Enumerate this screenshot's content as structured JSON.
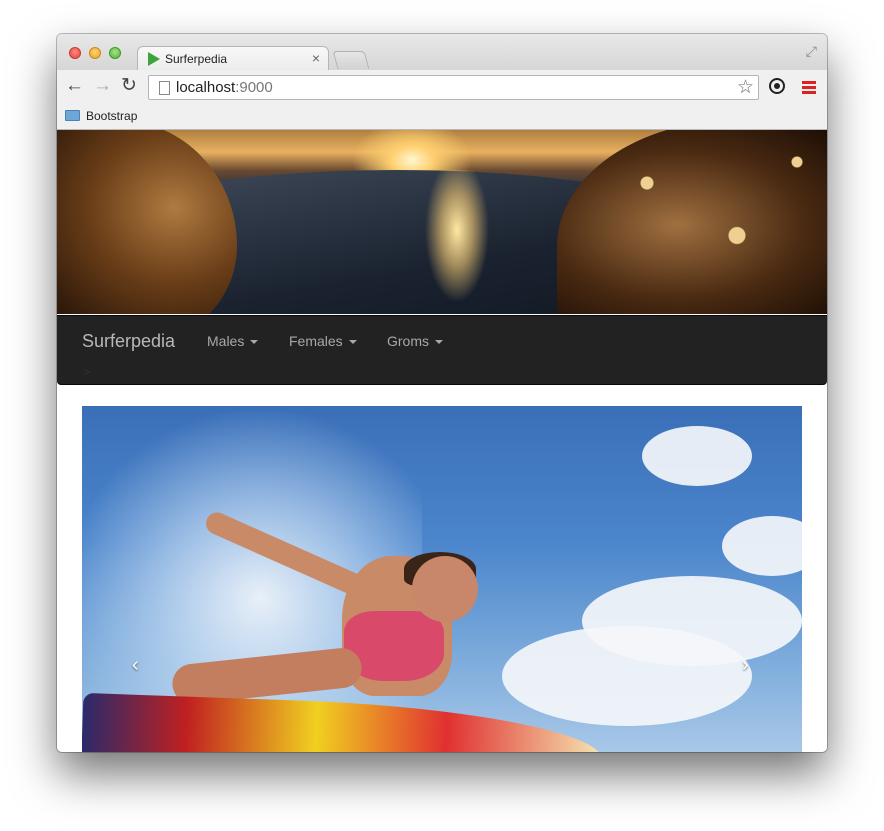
{
  "browser": {
    "tab": {
      "title": "Surferpedia",
      "close_glyph": "×"
    },
    "url": {
      "host": "localhost",
      "port": ":9000"
    },
    "bookmarks": [
      {
        "label": "Bootstrap",
        "icon": "folder-icon"
      }
    ],
    "icons": {
      "back": "←",
      "forward": "→",
      "reload": "↻",
      "star": "☆",
      "fullscreen": "⤢"
    },
    "traffic_lights": {
      "close": "#e0443e",
      "minimize": "#e6a21f",
      "maximize": "#52b43a"
    }
  },
  "navbar": {
    "brand": "Surferpedia",
    "items": [
      {
        "label": "Males",
        "dropdown": true
      },
      {
        "label": "Females",
        "dropdown": true
      },
      {
        "label": "Groms",
        "dropdown": true
      }
    ],
    "breadcrumb": ">",
    "background": "#222222"
  },
  "carousel": {
    "prev_glyph": "‹",
    "next_glyph": "›"
  }
}
